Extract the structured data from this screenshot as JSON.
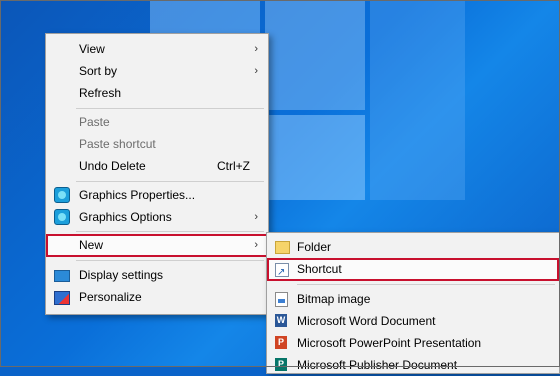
{
  "context_menu": {
    "items": {
      "view": {
        "label": "View"
      },
      "sort_by": {
        "label": "Sort by"
      },
      "refresh": {
        "label": "Refresh"
      },
      "paste": {
        "label": "Paste"
      },
      "paste_shortcut": {
        "label": "Paste shortcut"
      },
      "undo_delete": {
        "label": "Undo Delete",
        "shortcut": "Ctrl+Z"
      },
      "graphics_properties": {
        "label": "Graphics Properties...",
        "icon": "graphics-icon"
      },
      "graphics_options": {
        "label": "Graphics Options",
        "icon": "graphics-icon"
      },
      "new": {
        "label": "New"
      },
      "display_settings": {
        "label": "Display settings",
        "icon": "display-icon"
      },
      "personalize": {
        "label": "Personalize",
        "icon": "personalize-icon"
      }
    },
    "arrow": "›"
  },
  "new_submenu": {
    "items": {
      "folder": {
        "label": "Folder",
        "icon": "folder-icon"
      },
      "shortcut": {
        "label": "Shortcut",
        "icon": "shortcut-icon"
      },
      "bitmap": {
        "label": "Bitmap image",
        "icon": "bitmap-icon"
      },
      "word": {
        "label": "Microsoft Word Document",
        "icon": "word-icon",
        "glyph": "W"
      },
      "powerpoint": {
        "label": "Microsoft PowerPoint Presentation",
        "icon": "powerpoint-icon",
        "glyph": "P"
      },
      "publisher": {
        "label": "Microsoft Publisher Document",
        "icon": "publisher-icon",
        "glyph": "P"
      }
    }
  },
  "highlight_color": "#c8102e"
}
